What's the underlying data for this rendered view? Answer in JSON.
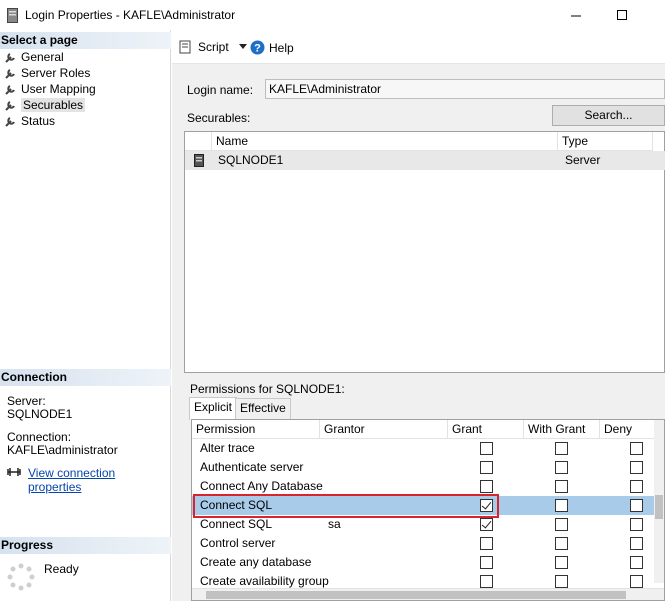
{
  "window": {
    "title": "Login Properties - KAFLE\\Administrator"
  },
  "left": {
    "select_page_header": "Select a page",
    "pages": [
      {
        "label": "General",
        "icon": "wrench-icon"
      },
      {
        "label": "Server Roles",
        "icon": "wrench-icon"
      },
      {
        "label": "User Mapping",
        "icon": "wrench-icon"
      },
      {
        "label": "Securables",
        "icon": "wrench-icon"
      },
      {
        "label": "Status",
        "icon": "wrench-icon"
      }
    ],
    "connection_header": "Connection",
    "server_label": "Server:",
    "server_value": "SQLNODE1",
    "connection_label": "Connection:",
    "connection_value": "KAFLE\\administrator",
    "view_connection_link": "View connection properties",
    "progress_header": "Progress",
    "progress_status": "Ready"
  },
  "toolbar": {
    "script_label": "Script",
    "help_label": "Help"
  },
  "form": {
    "login_name_label": "Login name:",
    "login_name_value": "KAFLE\\Administrator",
    "securables_label": "Securables:",
    "search_button": "Search...",
    "securables_columns": [
      "Name",
      "Type"
    ],
    "securables_rows": [
      {
        "name": "SQLNODE1",
        "type": "Server"
      }
    ],
    "permissions_label": "Permissions for SQLNODE1:",
    "tabs": [
      "Explicit",
      "Effective"
    ],
    "perm_columns": [
      "Permission",
      "Grantor",
      "Grant",
      "With Grant",
      "Deny"
    ],
    "perm_rows": [
      {
        "permission": "Alter trace",
        "grantor": "",
        "grant": false,
        "with_grant": false,
        "deny": false
      },
      {
        "permission": "Authenticate server",
        "grantor": "",
        "grant": false,
        "with_grant": false,
        "deny": false
      },
      {
        "permission": "Connect Any Database",
        "grantor": "",
        "grant": false,
        "with_grant": false,
        "deny": false
      },
      {
        "permission": "Connect SQL",
        "grantor": "",
        "grant": true,
        "with_grant": false,
        "deny": false
      },
      {
        "permission": "Connect SQL",
        "grantor": "sa",
        "grant": true,
        "with_grant": false,
        "deny": false
      },
      {
        "permission": "Control server",
        "grantor": "",
        "grant": false,
        "with_grant": false,
        "deny": false
      },
      {
        "permission": "Create any database",
        "grantor": "",
        "grant": false,
        "with_grant": false,
        "deny": false
      },
      {
        "permission": "Create availability group",
        "grantor": "",
        "grant": false,
        "with_grant": false,
        "deny": false
      }
    ]
  },
  "colors": {
    "selected_row": "#a9cbea",
    "highlight_box": "#d9232e",
    "link": "#0645ad"
  }
}
